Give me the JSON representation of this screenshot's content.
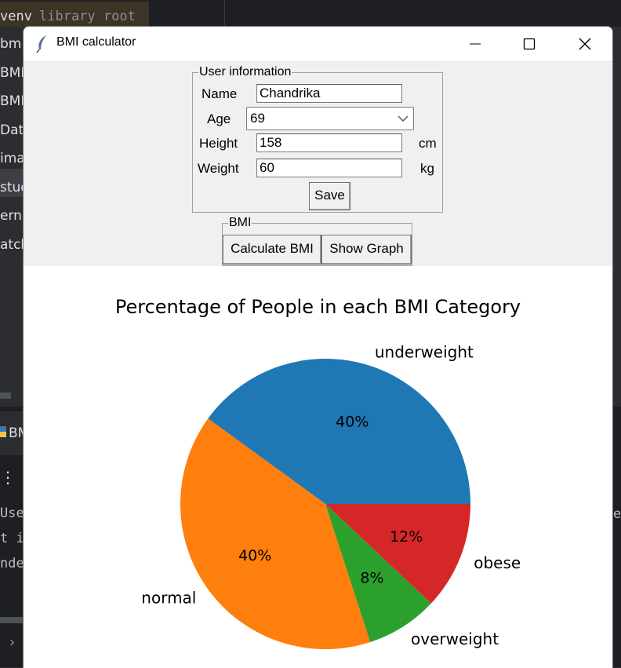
{
  "ide": {
    "venv_label": "venv",
    "library_root_label": "library root",
    "sidebar_files": [
      "bmi.",
      "BMI",
      "BMIc",
      "Data",
      "imag",
      "stud",
      "erna",
      "atch"
    ],
    "run_tab_label": "BM",
    "console_lines": [
      "Use",
      "t i",
      "nde"
    ],
    "right_edge_text": "e"
  },
  "window": {
    "title": "BMI calculator",
    "icon": "feather-icon",
    "minimize_icon": "minimize-icon",
    "maximize_icon": "maximize-icon",
    "close_icon": "close-icon"
  },
  "user_info": {
    "legend": "User information",
    "name_label": "Name",
    "name_value": "Chandrika",
    "age_label": "Age",
    "age_value": "69",
    "height_label": "Height",
    "height_value": "158",
    "height_unit": "cm",
    "weight_label": "Weight",
    "weight_value": "60",
    "weight_unit": "kg",
    "save_label": "Save"
  },
  "bmi": {
    "legend": "BMI",
    "calculate_label": "Calculate BMI",
    "graph_label": "Show Graph"
  },
  "chart_data": {
    "type": "pie",
    "title": "Percentage of People in each BMI Category",
    "start_angle_deg": 0,
    "direction": "counterclockwise",
    "slices": [
      {
        "label": "underweight",
        "value": 40,
        "pct_label": "40%",
        "color": "#1f77b4"
      },
      {
        "label": "normal",
        "value": 40,
        "pct_label": "40%",
        "color": "#ff7f0e"
      },
      {
        "label": "overweight",
        "value": 8,
        "pct_label": "8%",
        "color": "#2ca02c"
      },
      {
        "label": "obese",
        "value": 12,
        "pct_label": "12%",
        "color": "#d62728"
      }
    ]
  }
}
